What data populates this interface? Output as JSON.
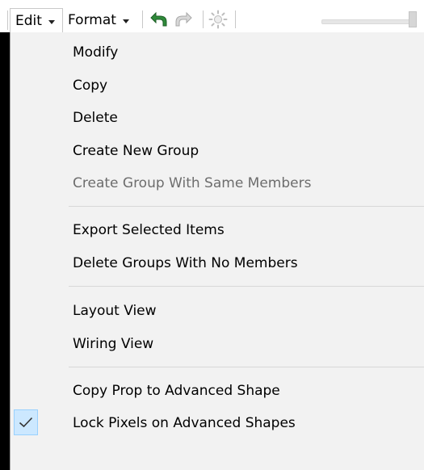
{
  "toolbar": {
    "edit_label": "Edit",
    "format_label": "Format",
    "icons": {
      "undo": "undo-arrow-icon",
      "redo": "redo-arrow-icon",
      "brightness": "brightness-sun-icon"
    },
    "slider_level": 0.96
  },
  "menu": {
    "items": [
      {
        "label": "Modify",
        "enabled": true,
        "checked": false
      },
      {
        "label": "Copy",
        "enabled": true,
        "checked": false
      },
      {
        "label": "Delete",
        "enabled": true,
        "checked": false
      },
      {
        "label": "Create New Group",
        "enabled": true,
        "checked": false
      },
      {
        "label": "Create Group With Same Members",
        "enabled": false,
        "checked": false
      },
      {
        "label": "Export Selected Items",
        "enabled": true,
        "checked": false
      },
      {
        "label": "Delete Groups With No Members",
        "enabled": true,
        "checked": false
      },
      {
        "label": "Layout View",
        "enabled": true,
        "checked": false
      },
      {
        "label": "Wiring View",
        "enabled": true,
        "checked": false
      },
      {
        "label": "Copy Prop to Advanced Shape",
        "enabled": true,
        "checked": false
      },
      {
        "label": "Lock Pixels on Advanced Shapes",
        "enabled": true,
        "checked": true
      }
    ]
  },
  "colors": {
    "menu_background": "#f2f2f2",
    "disabled_text": "#6d6d6d",
    "check_highlight": "#cce8ff",
    "undo_green": "#2f8a3a"
  }
}
